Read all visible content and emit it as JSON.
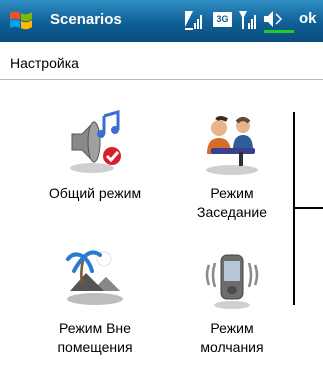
{
  "window": {
    "title": "Scenarios",
    "ok_label": "ok",
    "network_type": "3G"
  },
  "tray_icons": [
    "signal-icon",
    "3g-icon",
    "signal-icon",
    "volume-icon",
    "battery-icon"
  ],
  "page": {
    "subtitle": "Настройка"
  },
  "scenarios": [
    {
      "label": "Общий режим",
      "icon": "speaker-music-icon"
    },
    {
      "label": "Режим\nЗаседание",
      "icon": "meeting-people-icon"
    },
    {
      "label": "Режим Вне\nпомещения",
      "icon": "outdoor-palm-icon"
    },
    {
      "label": "Режим\nмолчания",
      "icon": "vibrating-phone-icon"
    }
  ],
  "colors": {
    "titlebar": "#0f5f95",
    "accent": "#2f8ec2",
    "battery": "#22cc22"
  }
}
